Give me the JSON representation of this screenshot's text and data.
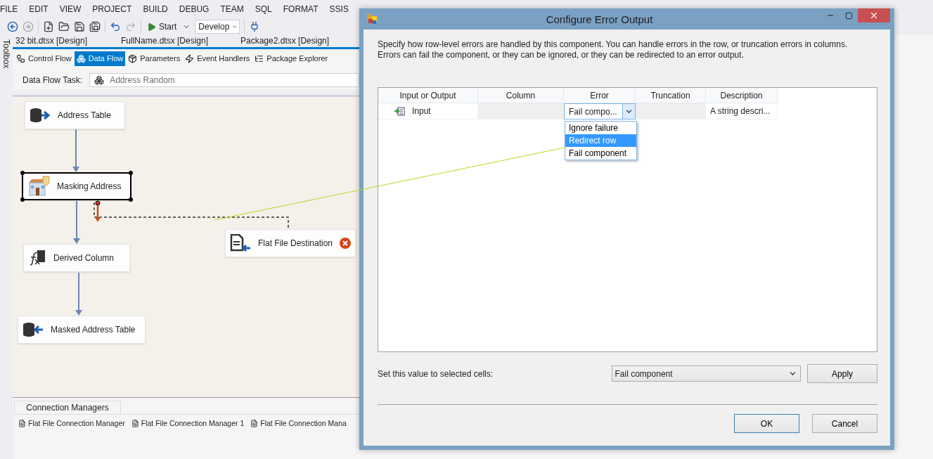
{
  "menu": [
    "FILE",
    "EDIT",
    "VIEW",
    "PROJECT",
    "BUILD",
    "DEBUG",
    "TEAM",
    "SQL",
    "FORMAT",
    "SSIS"
  ],
  "toolbar": {
    "start": "Start",
    "configuration": "Develop"
  },
  "toolbox_label": "Toolbox",
  "document_tabs": [
    {
      "label": "32 bit.dtsx [Design]",
      "selected": false
    },
    {
      "label": "FullName.dtsx [Design]",
      "selected": false
    },
    {
      "label": "Package2.dtsx [Design]",
      "selected": false
    }
  ],
  "designer_tabs": [
    {
      "label": "Control Flow",
      "kind": "control",
      "selected": false
    },
    {
      "label": "Data Flow",
      "kind": "data",
      "selected": true
    },
    {
      "label": "Parameters",
      "kind": "params",
      "selected": false
    },
    {
      "label": "Event Handlers",
      "kind": "events",
      "selected": false
    },
    {
      "label": "Package Explorer",
      "kind": "explorer",
      "selected": false
    }
  ],
  "data_flow_task": {
    "label": "Data Flow Task:",
    "value": "Address Random"
  },
  "components": [
    {
      "name": "Address Table",
      "kind": "source",
      "selected": false,
      "error": false
    },
    {
      "name": "Masking Address",
      "kind": "transform",
      "selected": true,
      "error": false
    },
    {
      "name": "Derived Column",
      "kind": "derived",
      "selected": false,
      "error": false
    },
    {
      "name": "Masked Address Table",
      "kind": "destination",
      "selected": false,
      "error": false
    },
    {
      "name": "Flat File Destination",
      "kind": "flatfile",
      "selected": false,
      "error": true
    }
  ],
  "connection_managers": {
    "tab": "Connection Managers",
    "items": [
      "Flat File Connection Manager",
      "Flat File Connection Manager 1",
      "Flat File Connection Mana"
    ]
  },
  "dialog": {
    "title": "Configure Error Output",
    "description": "Specify how row-level errors are handled by this component. You can handle errors in the row, or truncation errors in columns. Errors can fail the component, or they can be ignored, or they can be redirected to an error output.",
    "columns": [
      "Input or Output",
      "Column",
      "Error",
      "Truncation",
      "Description"
    ],
    "rows": [
      {
        "input_or_output": "Input",
        "error": "Fail compo...",
        "description": "A string descri..."
      }
    ],
    "error_options": [
      {
        "label": "Ignore failure",
        "selected": false
      },
      {
        "label": "Redirect row",
        "selected": true
      },
      {
        "label": "Fail component",
        "selected": false
      }
    ],
    "set_value_label": "Set this value to selected cells:",
    "set_value": "Fail component",
    "apply": "Apply",
    "ok": "OK",
    "cancel": "Cancel"
  }
}
